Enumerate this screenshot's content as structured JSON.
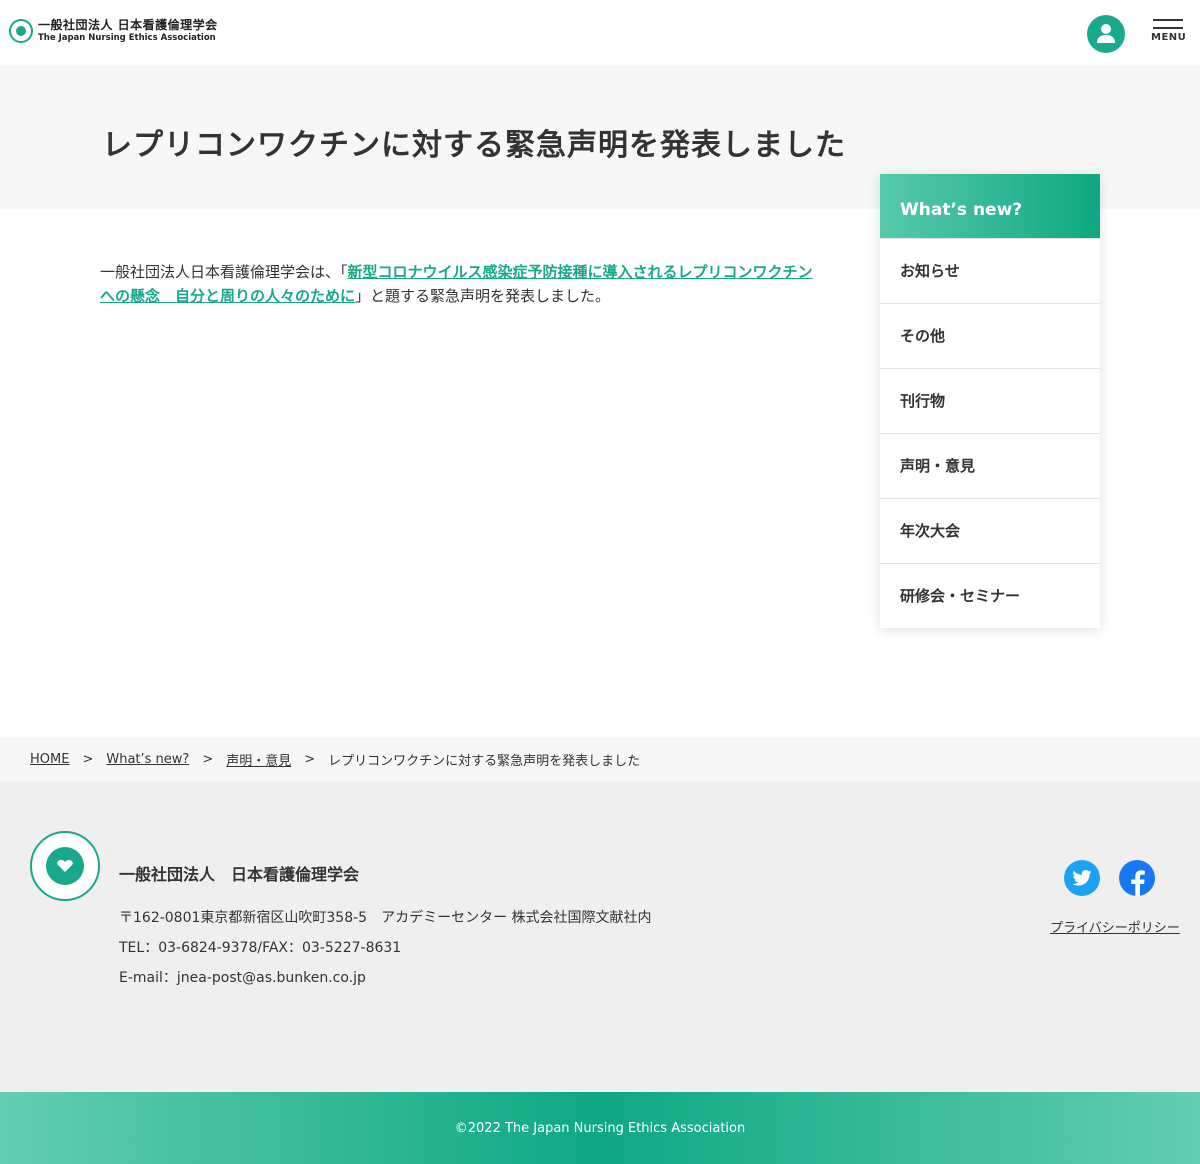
{
  "header": {
    "logo_jp": "一般社団法人 日本看護倫理学会",
    "logo_en": "The Japan Nursing Ethics Association",
    "menu_label": "MENU"
  },
  "page": {
    "title": "レプリコンワクチンに対する緊急声明を発表しました"
  },
  "intro": {
    "prefix": "一般社団法人日本看護倫理学会は、「",
    "link_text": "新型コロナウイルス感染症予防接種に導入されるレプリコンワクチンへの懸念　自分と周りの人々のために",
    "suffix": "」と題する緊急声明を発表しました。"
  },
  "sidebar": {
    "heading": "What’s new?",
    "items": [
      {
        "label": "お知らせ"
      },
      {
        "label": "その他"
      },
      {
        "label": "刊行物"
      },
      {
        "label": "声明・意見"
      },
      {
        "label": "年次大会"
      },
      {
        "label": "研修会・セミナー"
      }
    ]
  },
  "breadcrumb": {
    "sep": ">",
    "items": [
      {
        "label": "HOME"
      },
      {
        "label": "What’s new?"
      },
      {
        "label": "声明・意見"
      },
      {
        "label": "レプリコンワクチンに対する緊急声明を発表しました"
      }
    ]
  },
  "footer": {
    "org_name": "一般社団法人　日本看護倫理学会",
    "address": "〒162-0801東京都新宿区山吹町358-5　アカデミーセンター 株式会社国際文献社内",
    "tel": "TEL：03-6824-9378/FAX：03-5227-8631",
    "email": "E-mail：jnea-post@as.bunken.co.jp",
    "privacy": "プライバシーポリシー",
    "copyright": "©2022 The Japan Nursing Ethics Association"
  },
  "colors": {
    "accent": "#1aa88a",
    "twitter": "#1da1f2",
    "facebook": "#1877f2"
  }
}
